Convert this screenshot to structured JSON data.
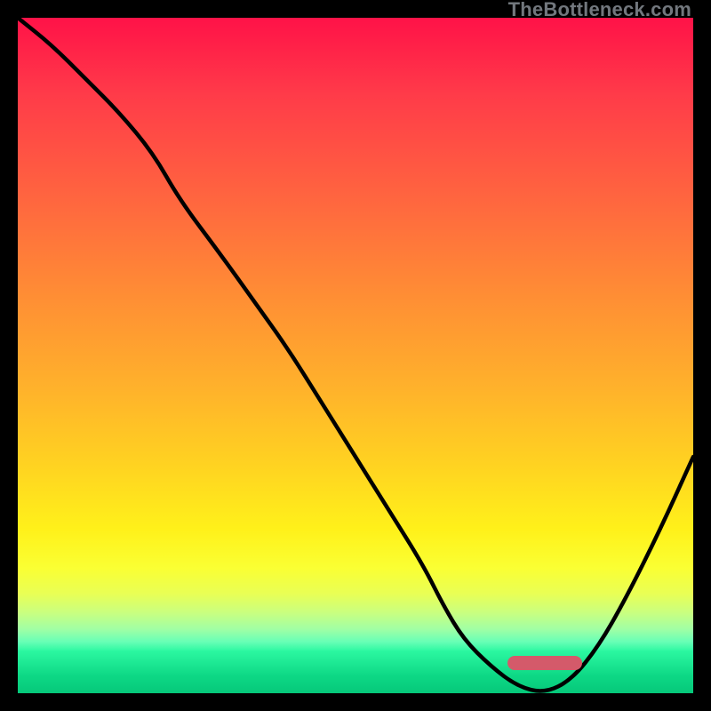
{
  "watermark": "TheBottleneck.com",
  "colors": {
    "frame": "#000000",
    "pill": "#d45a6a",
    "curve": "#000000"
  },
  "chart_data": {
    "type": "line",
    "title": "",
    "xlabel": "",
    "ylabel": "",
    "xlim": [
      0,
      100
    ],
    "ylim": [
      0,
      100
    ],
    "series": [
      {
        "name": "bottleneck-curve",
        "x": [
          0,
          5,
          10,
          15,
          20,
          24,
          30,
          35,
          40,
          45,
          50,
          55,
          60,
          63,
          66,
          70,
          74,
          78,
          82,
          86,
          90,
          95,
          100
        ],
        "y": [
          100,
          96,
          91,
          86,
          80,
          73,
          65,
          58,
          51,
          43,
          35,
          27,
          19,
          13,
          8,
          4,
          1,
          0,
          2,
          7,
          14,
          24,
          35
        ]
      }
    ],
    "optimum_marker": {
      "x": 78,
      "width_percent": 11
    },
    "background_gradient": {
      "stops": [
        {
          "pos": 0,
          "color": "#ff1248"
        },
        {
          "pos": 0.12,
          "color": "#ff3b49"
        },
        {
          "pos": 0.3,
          "color": "#ff6a3e"
        },
        {
          "pos": 0.44,
          "color": "#ff8f34"
        },
        {
          "pos": 0.58,
          "color": "#ffb22b"
        },
        {
          "pos": 0.7,
          "color": "#ffd321"
        },
        {
          "pos": 0.8,
          "color": "#fff11a"
        },
        {
          "pos": 0.86,
          "color": "#faff33"
        },
        {
          "pos": 0.9,
          "color": "#e9ff55"
        },
        {
          "pos": 0.93,
          "color": "#c9ff80"
        },
        {
          "pos": 0.955,
          "color": "#a1ffa4"
        },
        {
          "pos": 0.975,
          "color": "#68ffb6"
        },
        {
          "pos": 0.99,
          "color": "#2cf8a1"
        },
        {
          "pos": 1.0,
          "color": "#0cd983"
        }
      ]
    }
  }
}
